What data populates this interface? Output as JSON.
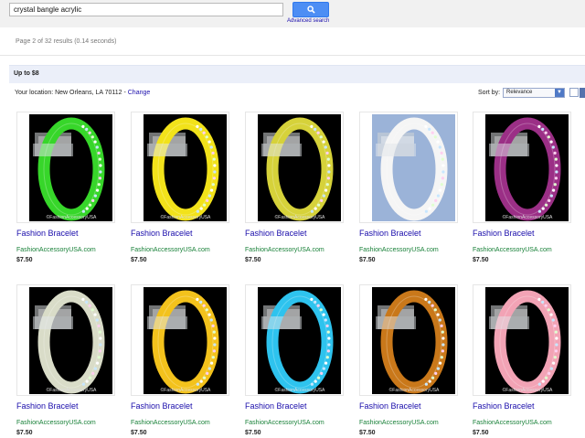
{
  "search": {
    "query": "crystal bangle acrylic",
    "advanced_label": "Advanced search"
  },
  "results_info": "Page 2 of 32 results (0.14 seconds)",
  "filter": {
    "price_label": "Up to $8"
  },
  "location": {
    "prefix": "Your location: New Orleans, LA 70112 - ",
    "change_label": "Change"
  },
  "sort": {
    "label": "Sort by:",
    "selected": "Relevance"
  },
  "products": [
    {
      "title": "Fashion Bracelet",
      "seller": "FashionAccessoryUSA.com",
      "price": "$7.50",
      "color": "#37d62a",
      "bg": "#000000",
      "watermark": "©FashionAccessoryUSA"
    },
    {
      "title": "Fashion Bracelet",
      "seller": "FashionAccessoryUSA.com",
      "price": "$7.50",
      "color": "#f2e21a",
      "bg": "#000000",
      "watermark": "©FashionAccessoryUSA"
    },
    {
      "title": "Fashion Bracelet",
      "seller": "FashionAccessoryUSA.com",
      "price": "$7.50",
      "color": "#d6d23a",
      "bg": "#000000",
      "watermark": "©FashionAccessoryUSA"
    },
    {
      "title": "Fashion Bracelet",
      "seller": "FashionAccessoryUSA.com",
      "price": "$7.50",
      "color": "#f5f5f5",
      "bg": "#9bb3d8",
      "watermark": ""
    },
    {
      "title": "Fashion Bracelet",
      "seller": "FashionAccessoryUSA.com",
      "price": "$7.50",
      "color": "#9b2f86",
      "bg": "#000000",
      "watermark": "©FashionAccessoryUSA"
    },
    {
      "title": "Fashion Bracelet",
      "seller": "FashionAccessoryUSA.com",
      "price": "$7.50",
      "color": "#d9dcc8",
      "bg": "#000000",
      "watermark": "©FashionAccessoryUSA"
    },
    {
      "title": "Fashion Bracelet",
      "seller": "FashionAccessoryUSA.com",
      "price": "$7.50",
      "color": "#f3c21c",
      "bg": "#000000",
      "watermark": "©FashionAccessoryUSA"
    },
    {
      "title": "Fashion Bracelet",
      "seller": "FashionAccessoryUSA.com",
      "price": "$7.50",
      "color": "#2ec3ee",
      "bg": "#000000",
      "watermark": "©FashionAccessoryUSA"
    },
    {
      "title": "Fashion Bracelet",
      "seller": "FashionAccessoryUSA.com",
      "price": "$7.50",
      "color": "#c9781a",
      "bg": "#000000",
      "watermark": "©FashionAccessoryUSA"
    },
    {
      "title": "Fashion Bracelet",
      "seller": "FashionAccessoryUSA.com",
      "price": "$7.50",
      "color": "#f2a3b5",
      "bg": "#000000",
      "watermark": "©FashionAccessoryUSA"
    }
  ]
}
